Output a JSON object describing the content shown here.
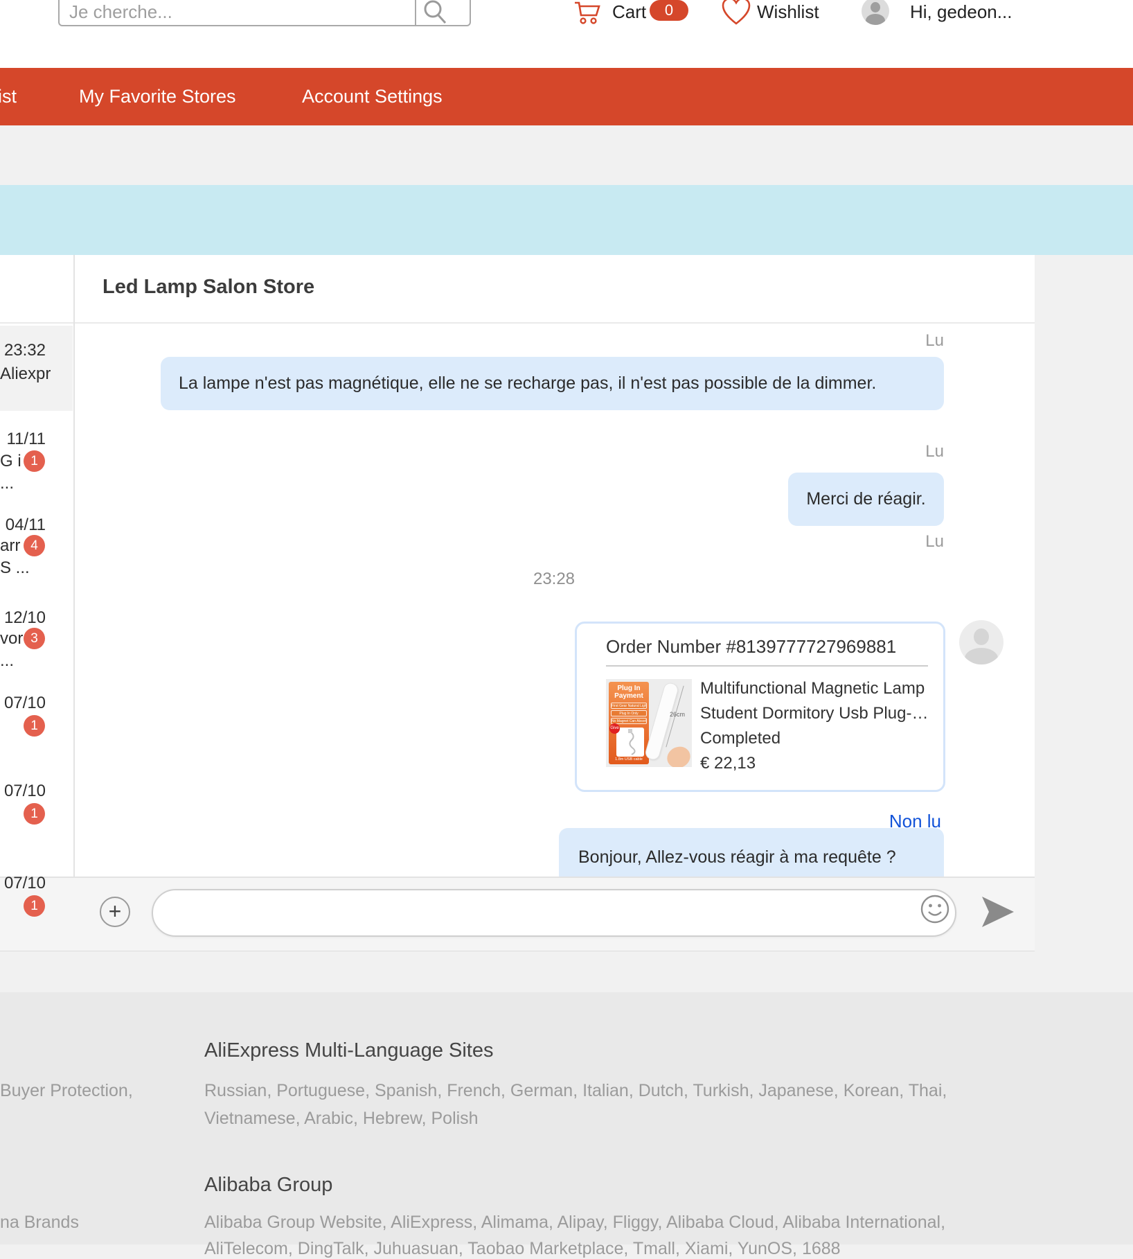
{
  "header": {
    "search": {
      "placeholder": "Je cherche..."
    },
    "cart": {
      "label": "Cart",
      "count": "0"
    },
    "wishlist": {
      "label": "Wishlist"
    },
    "greeting": "Hi, gedeon..."
  },
  "nav": {
    "items": [
      {
        "label": "List"
      },
      {
        "label": "My Favorite Stores"
      },
      {
        "label": "Account Settings"
      }
    ]
  },
  "sidebar": {
    "conversations": [
      {
        "time": "23:32",
        "name_fragment": "Aliexpr",
        "badge": "",
        "extra": "",
        "selected": true
      },
      {
        "time": "11/11",
        "name_fragment": "G i",
        "badge": "1",
        "extra": "..."
      },
      {
        "time": "04/11",
        "name_fragment": "arr",
        "badge": "4",
        "extra": "S ..."
      },
      {
        "time": "12/10",
        "name_fragment": "vor",
        "badge": "3",
        "extra": "..."
      },
      {
        "time": "07/10",
        "name_fragment": "",
        "badge": "1",
        "extra": ""
      },
      {
        "time": "07/10",
        "name_fragment": "",
        "badge": "1",
        "extra": ""
      },
      {
        "time": "07/10",
        "name_fragment": "",
        "badge": "1",
        "extra": ""
      }
    ]
  },
  "chat": {
    "store_name": "Led Lamp Salon Store",
    "read_label": "Lu",
    "unread_label": "Non lu",
    "timestamp": "23:28",
    "messages": [
      {
        "text": "La lampe n'est pas magnétique, elle ne se recharge pas, il n'est pas possible de la dimmer."
      },
      {
        "text": "Merci de réagir."
      },
      {
        "text": "Bonjour, Allez-vous réagir à ma requête ?"
      }
    ],
    "order_card": {
      "title": "Order Number #8139777727969881",
      "product_title_line1": "Multifunctional Magnetic Lamp",
      "product_title_line2": "Student Dormitory Usb Plug-…",
      "status": "Completed",
      "price": "€ 22,13",
      "image_labels": {
        "head1": "Plug In",
        "head2": "Payment",
        "pill1": "First Gear Natural Light",
        "pill2": "Plug In Only",
        "pill3": "No Magnet Can Absorb",
        "give": "Give",
        "cable": "1.8m USB cable",
        "size": "26cm"
      }
    },
    "input": {
      "plus_label": "+"
    }
  },
  "footer": {
    "col_left": {
      "fragment1": "Buyer Protection,",
      "fragment2": "na Brands"
    },
    "multilang": {
      "heading": "AliExpress Multi-Language Sites",
      "line1": "Russian, Portuguese, Spanish, French, German, Italian, Dutch, Turkish, Japanese, Korean, Thai,",
      "line2": "Vietnamese, Arabic, Hebrew, Polish"
    },
    "alibaba": {
      "heading": "Alibaba Group",
      "line1": "Alibaba Group Website, AliExpress, Alimama, Alipay, Fliggy, Alibaba Cloud, Alibaba International,",
      "line2": "AliTelecom, DingTalk, Juhuasuan, Taobao Marketplace, Tmall, Xiami, YunOS, 1688"
    }
  },
  "colors": {
    "brand_red": "#d5472a",
    "badge_red": "#e4604e",
    "banner_blue": "#c8eaf2",
    "bubble_blue": "#dcebfb",
    "card_border_blue": "#d3e4fa",
    "unread_blue": "#1253d9"
  }
}
